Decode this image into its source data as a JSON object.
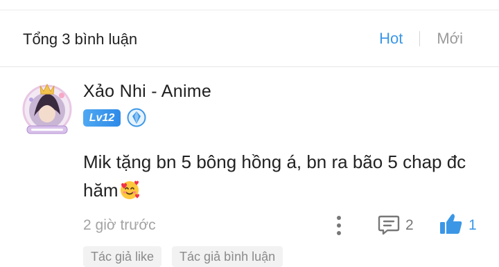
{
  "header": {
    "title": "Tổng 3 bình luận",
    "sort_hot": "Hot",
    "sort_new": "Mới"
  },
  "comment": {
    "username": "Xảo Nhi - Anime",
    "level": "Lv12",
    "text": "Mik tặng bn 5 bông hồng á, bn ra bão 5 chap đc hăm",
    "time": "2 giờ trước",
    "reply_count": "2",
    "like_count": "1",
    "tags": [
      "Tác giả like",
      "Tác giả bình luận"
    ]
  },
  "icons": {
    "avatar": "avatar-frame-icon",
    "gem": "gem-badge-icon",
    "emoji": "smiling-face-with-hearts-icon",
    "more": "more-vertical-icon",
    "reply": "comment-reply-icon",
    "like": "thumbs-up-icon"
  },
  "colors": {
    "accent": "#3b97e6",
    "muted": "#a3a3a3",
    "tag_bg": "#f2f2f2"
  }
}
